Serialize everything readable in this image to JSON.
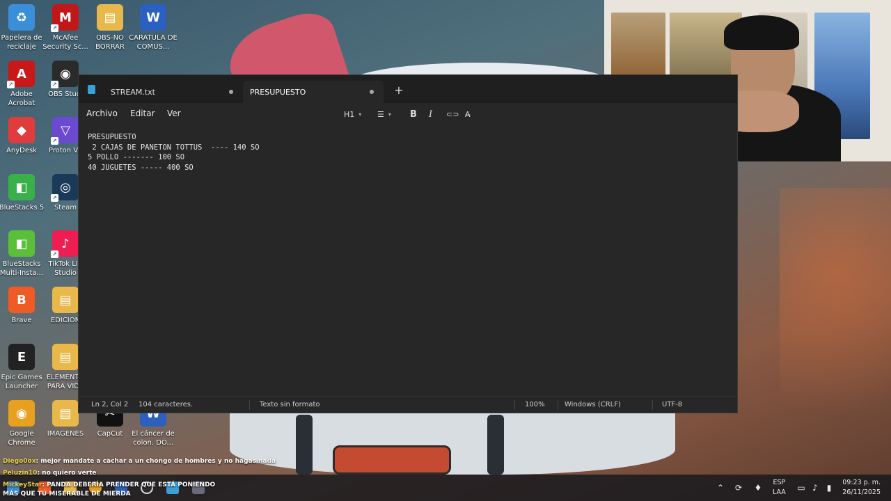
{
  "desktop": {
    "icons": [
      {
        "label": "Papelera de reciclaje",
        "glyph": "♻",
        "color": "#3a8fd8"
      },
      {
        "label": "McAfee Security Sc...",
        "glyph": "M",
        "color": "#c01818"
      },
      {
        "label": "OBS-NO BORRAR",
        "glyph": "▤",
        "color": "#e8b84a"
      },
      {
        "label": "CARATULA DE COMUS...",
        "glyph": "W",
        "color": "#2b5fc0"
      },
      {
        "label": "Adobe Acrobat",
        "glyph": "A",
        "color": "#c81818"
      },
      {
        "label": "OBS Studi",
        "glyph": "◉",
        "color": "#2a2a2a"
      },
      {
        "label": "AnyDesk",
        "glyph": "◆",
        "color": "#e03c3c"
      },
      {
        "label": "Proton VP",
        "glyph": "▽",
        "color": "#6a4ad0"
      },
      {
        "label": "BlueStacks 5",
        "glyph": "◧",
        "color": "#3ab04a"
      },
      {
        "label": "Steam",
        "glyph": "◎",
        "color": "#1b3a5a"
      },
      {
        "label": "BlueStacks Multi-Insta...",
        "glyph": "◧",
        "color": "#5ac03a"
      },
      {
        "label": "TikTok LIV Studio",
        "glyph": "♪",
        "color": "#ee1d52"
      },
      {
        "label": "Brave",
        "glyph": "B",
        "color": "#f05a24"
      },
      {
        "label": "EDICION",
        "glyph": "▤",
        "color": "#e8b84a"
      },
      {
        "label": "Epic Games Launcher",
        "glyph": "E",
        "color": "#222222"
      },
      {
        "label": "ELEMENTO PARA VIDE",
        "glyph": "▤",
        "color": "#e8b84a"
      },
      {
        "label": "Google Chrome",
        "glyph": "◉",
        "color": "#e8a020"
      },
      {
        "label": "IMAGENES",
        "glyph": "▤",
        "color": "#e8b84a"
      },
      {
        "label": "CapCut",
        "glyph": "✂",
        "color": "#111111"
      },
      {
        "label": "El cáncer de colon. DO...",
        "glyph": "W",
        "color": "#2b5fc0"
      }
    ]
  },
  "notepad": {
    "tabs": [
      {
        "label": "STREAM.txt"
      },
      {
        "label": "PRESUPUESTO"
      }
    ],
    "new_tab_glyph": "+",
    "menu": {
      "archivo": "Archivo",
      "editar": "Editar",
      "ver": "Ver"
    },
    "toolbar": {
      "heading": "H1",
      "list_glyph": "☰",
      "bold": "B",
      "italic": "I",
      "link_glyph": "⊂⊃",
      "clear_glyph": "A̶"
    },
    "content": "PRESUPUESTO\n 2 CAJAS DE PANETON TOTTUS  ---- 140 SO\n5 POLLO ------- 100 SO\n40 JUGUETES ----- 400 SO",
    "status": {
      "position": "Ln 2, Col 2",
      "characters": "104 caracteres.",
      "format": "Texto sin formato",
      "zoom": "100%",
      "line_ending": "Windows (CRLF)",
      "encoding": "UTF-8"
    }
  },
  "chat": [
    {
      "user": "Diego0ox",
      "message": ": mejor mandate a cachar a un chongo de hombres y no hagas nada"
    },
    {
      "user": "Peluzin10",
      "message": ": no quiero verte"
    },
    {
      "user": "MickeyStar",
      "message": ": PANDA DEBERÍA PRENDER QUE ESTÁ PONIENDO MÁS QUE TÚ MISERABLE DE MIERDA"
    }
  ],
  "taskbar": {
    "language": {
      "line1": "ESP",
      "line2": "LAA"
    },
    "time": "09:23 p. m.",
    "date": "26/11/2025"
  }
}
